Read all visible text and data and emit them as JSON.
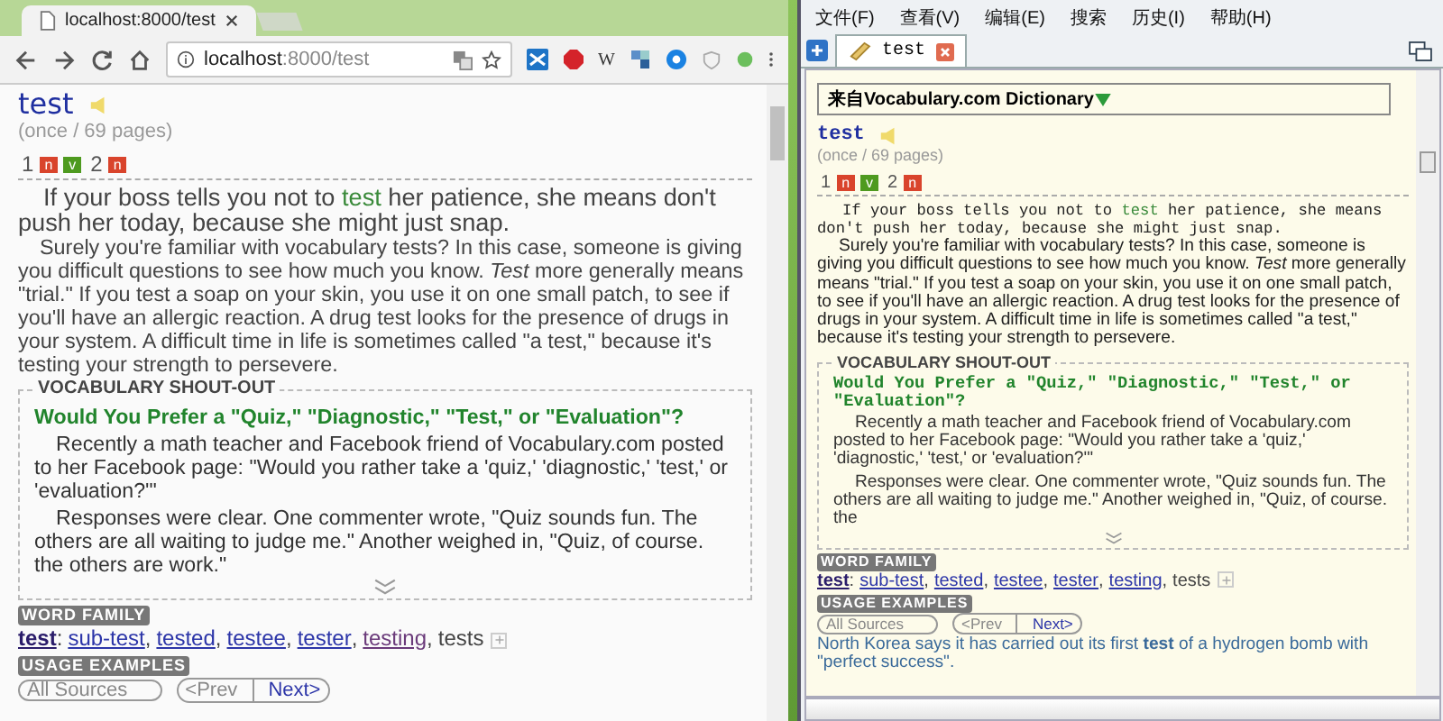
{
  "browser": {
    "tab_title": "localhost:8000/test",
    "address": {
      "host": "localhost",
      "rest": ":8000/test"
    },
    "extension_label": "W",
    "entry": {
      "word": "test",
      "frequency": "(once / 69 pages)",
      "senses": [
        {
          "number": "1",
          "tags": [
            {
              "label": "n",
              "kind": "noun"
            },
            {
              "label": "v",
              "kind": "verb"
            }
          ]
        },
        {
          "number": "2",
          "tags": [
            {
              "label": "n",
              "kind": "noun"
            }
          ]
        }
      ],
      "short": {
        "before": "If your boss tells you not to ",
        "highlight": "test",
        "after": " her patience, she means don't push her today, because she might just snap."
      },
      "long": "Surely you're familiar with vocabulary tests? In this case, someone is giving you difficult questions to see how much you know. *Test* more generally means \"trial.\" If you test a soap on your skin, you use it on one small patch, to see if you'll have an allergic reaction. A drug test looks for the presence of drugs in your system. A difficult time in life is sometimes called \"a test,\" because it's testing your strength to persevere.",
      "shout_out": {
        "heading": "VOCABULARY SHOUT-OUT",
        "title": "Would You Prefer a \"Quiz,\" \"Diagnostic,\" \"Test,\" or \"Evaluation\"?",
        "paragraphs": [
          "Recently a math teacher and Facebook friend of Vocabulary.com posted to her Facebook page: \"Would you rather take a 'quiz,' 'diagnostic,' 'test,' or 'evaluation?'\"",
          "Responses were clear. One commenter wrote, \"Quiz sounds fun. The others are all waiting to judge me.\" Another weighed in, \"Quiz, of course. the others are work.\""
        ]
      },
      "word_family": {
        "label": "WORD FAMILY",
        "items": [
          {
            "text": "test",
            "kind": "current",
            "separator": ":"
          },
          {
            "text": "sub-test",
            "kind": "link",
            "separator": ","
          },
          {
            "text": "tested",
            "kind": "link",
            "separator": ","
          },
          {
            "text": "testee",
            "kind": "link",
            "separator": ","
          },
          {
            "text": "tester",
            "kind": "link",
            "separator": ","
          },
          {
            "text": "testing",
            "kind": "visited",
            "separator": ","
          },
          {
            "text": "tests",
            "kind": "plain"
          }
        ]
      },
      "usage": {
        "label": "USAGE EXAMPLES",
        "source": "All Sources",
        "prev": "<Prev",
        "next": "Next>"
      }
    }
  },
  "dictionary": {
    "menu": [
      "文件(F)",
      "查看(V)",
      "编辑(E)",
      "搜索",
      "历史(I)",
      "帮助(H)"
    ],
    "tab_title": "test",
    "source": "来自Vocabulary.com Dictionary",
    "entry": {
      "word": "test",
      "frequency": "(once / 69 pages)",
      "senses": [
        {
          "number": "1",
          "tags": [
            {
              "label": "n",
              "kind": "noun"
            },
            {
              "label": "v",
              "kind": "verb"
            }
          ]
        },
        {
          "number": "2",
          "tags": [
            {
              "label": "n",
              "kind": "noun"
            }
          ]
        }
      ],
      "short": {
        "before": "If your boss tells you not to ",
        "highlight": "test",
        "after": " her patience, she means don't push her today, because she might just snap."
      },
      "long": "Surely you're familiar with vocabulary tests? In this case, someone is giving you difficult questions to see how much you know. *Test* more generally means \"trial.\" If you test a soap on your skin, you use it on one small patch, to see if you'll have an allergic reaction. A drug test looks for the presence of drugs in your system. A difficult time in life is sometimes called \"a test,\" because it's testing your strength to persevere.",
      "shout_out": {
        "heading": "VOCABULARY SHOUT-OUT",
        "title": "Would You Prefer a \"Quiz,\" \"Diagnostic,\" \"Test,\" or \"Evaluation\"?",
        "paragraphs": [
          "Recently a math teacher and Facebook friend of Vocabulary.com posted to her Facebook page: \"Would you rather take a 'quiz,' 'diagnostic,' 'test,' or 'evaluation?'\"",
          "Responses were clear. One commenter wrote, \"Quiz sounds fun. The others are all waiting to judge me.\" Another weighed in, \"Quiz, of course. the"
        ]
      },
      "word_family": {
        "label": "WORD FAMILY",
        "items": [
          {
            "text": "test",
            "kind": "current",
            "separator": ":"
          },
          {
            "text": "sub-test",
            "kind": "link",
            "separator": ","
          },
          {
            "text": "tested",
            "kind": "link",
            "separator": ","
          },
          {
            "text": "testee",
            "kind": "link",
            "separator": ","
          },
          {
            "text": "tester",
            "kind": "link",
            "separator": ","
          },
          {
            "text": "testing",
            "kind": "link",
            "separator": ","
          },
          {
            "text": "tests",
            "kind": "plain"
          }
        ]
      },
      "usage": {
        "label": "USAGE EXAMPLES",
        "source": "All Sources",
        "prev": "<Prev",
        "next": "Next>",
        "example": "North Korea says it has carried out its first **test** of a hydrogen bomb with \"perfect success\"."
      }
    }
  }
}
